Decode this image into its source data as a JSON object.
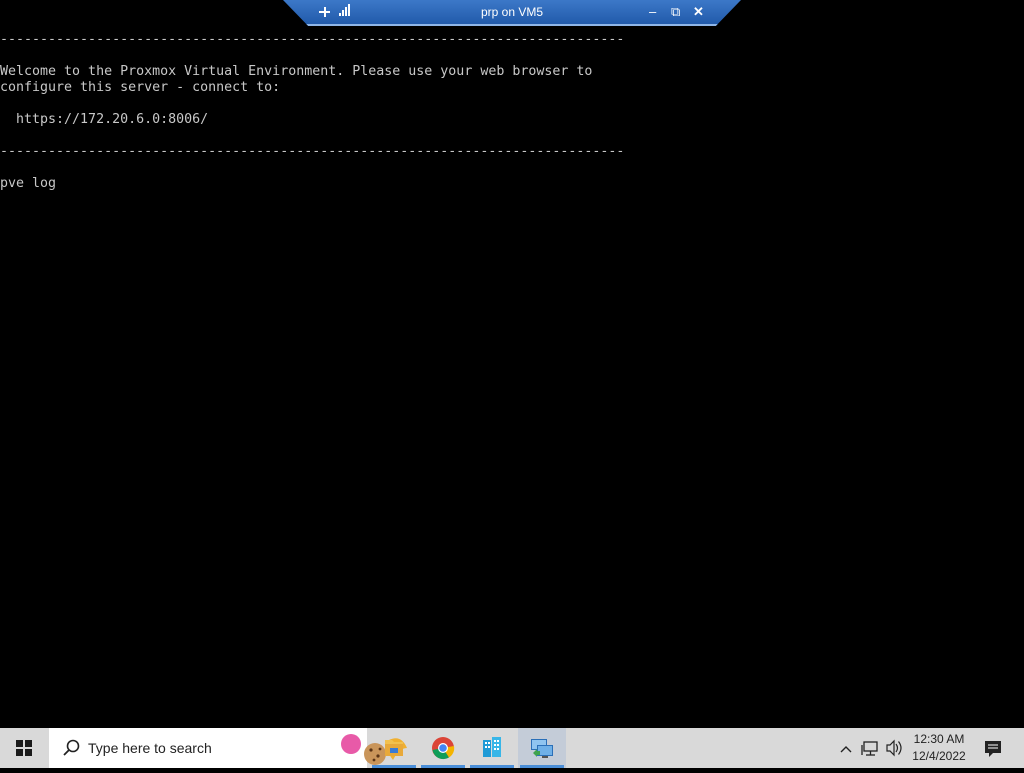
{
  "rdp_bar": {
    "title": "prp on VM5",
    "minimize": "–",
    "restore": "⧉",
    "close": "✕"
  },
  "terminal": {
    "text": "------------------------------------------------------------------------------\n\nWelcome to the Proxmox Virtual Environment. Please use your web browser to\nconfigure this server - connect to:\n\n  https://172.20.6.0:8006/\n\n------------------------------------------------------------------------------\n\npve log"
  },
  "taskbar": {
    "search_placeholder": "Type here to search",
    "apps": [
      {
        "name": "File Explorer",
        "icon": "folder-icon"
      },
      {
        "name": "Google Chrome",
        "icon": "chrome-icon"
      },
      {
        "name": "Server app",
        "icon": "building-icon"
      },
      {
        "name": "Remote Desktop Connection",
        "icon": "remote-desktop-icon"
      }
    ],
    "tray": {
      "time": "12:30 AM",
      "date": "12/4/2022"
    }
  },
  "colors": {
    "rdp_bar": "#2a64b4",
    "terminal_bg": "#000000",
    "terminal_fg": "#c8c8c8",
    "taskbar_bg": "#d9d9d9",
    "accent": "#4a8ed8"
  }
}
